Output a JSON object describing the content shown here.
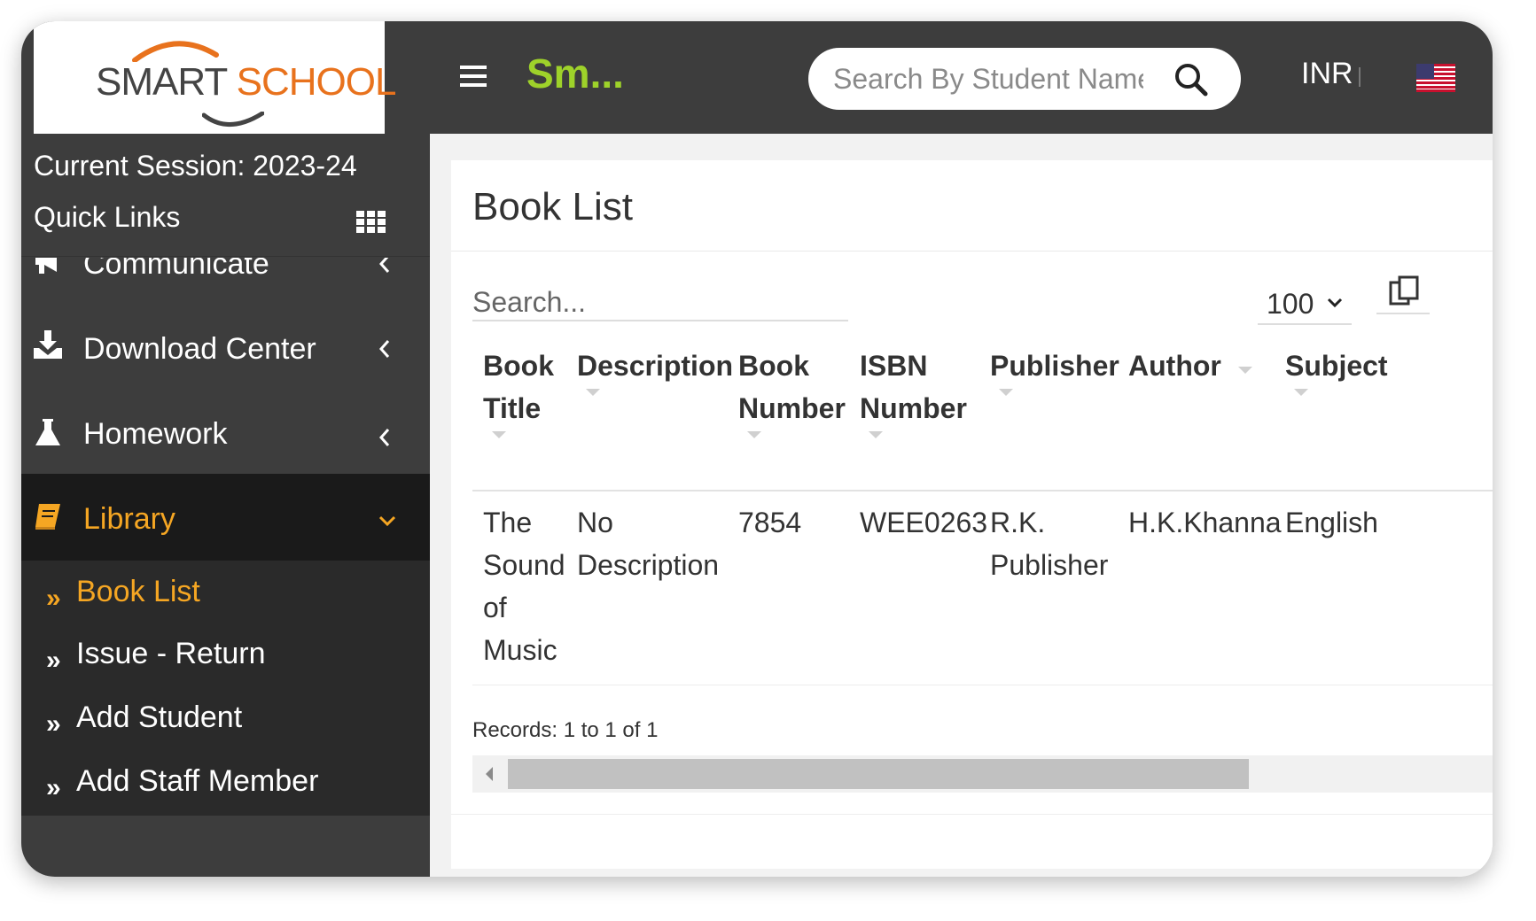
{
  "header": {
    "logo_word1": "SMART",
    "logo_word2": "SCHOOL",
    "brand_short": "Sm...",
    "search_placeholder": "Search By Student Name",
    "currency": "INR",
    "flag_icon": "us-flag-icon",
    "accent_color": "#9ed22a"
  },
  "sidebar": {
    "session_label": "Current Session: 2023-24",
    "quick_links_label": "Quick Links",
    "items": [
      {
        "label": "Communicate",
        "icon": "megaphone-icon"
      },
      {
        "label": "Download Center",
        "icon": "download-icon"
      },
      {
        "label": "Homework",
        "icon": "flask-icon"
      },
      {
        "label": "Library",
        "icon": "book-icon",
        "active": true
      }
    ],
    "submenu": [
      {
        "label": "Book List",
        "active": true
      },
      {
        "label": "Issue - Return"
      },
      {
        "label": "Add Student"
      },
      {
        "label": "Add Staff Member"
      }
    ],
    "active_color": "#f5a623"
  },
  "main": {
    "title": "Book List",
    "search_placeholder": "Search...",
    "page_size": "100",
    "columns": [
      "Book Title",
      "Description",
      "Book Number",
      "ISBN Number",
      "Publisher",
      "Author",
      "Subject"
    ],
    "rows": [
      {
        "book_title": "The Sound of Music",
        "description": "No Description",
        "book_number": "7854",
        "isbn": "WEE0263",
        "publisher": "R.K. Publisher",
        "author": "H.K.Khanna",
        "subject": "English"
      }
    ],
    "records_text": "Records: 1 to 1 of 1"
  }
}
